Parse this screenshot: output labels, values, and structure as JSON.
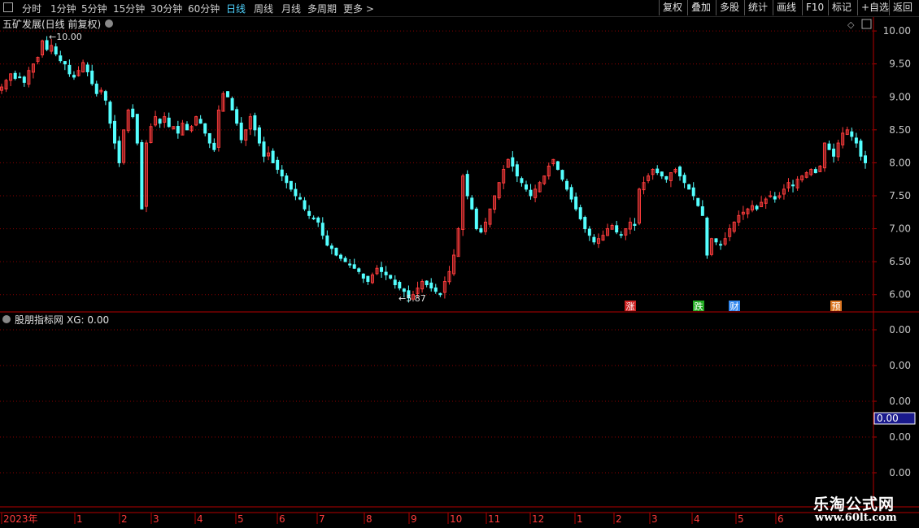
{
  "toolbar": {
    "periods": [
      "分时",
      "1分钟",
      "5分钟",
      "15分钟",
      "30分钟",
      "60分钟",
      "日线",
      "周线",
      "月线",
      "多周期",
      "更多 >"
    ],
    "active_period": "日线",
    "right_buttons": [
      "复权",
      "叠加",
      "多股",
      "统计",
      "画线",
      "F10",
      "标记",
      "+自选",
      "返回"
    ]
  },
  "main_panel": {
    "title": "五矿发展(日线 前复权)",
    "high_label": "10.00",
    "low_label": "5.87",
    "y_ticks": [
      "10.00",
      "9.50",
      "9.00",
      "8.50",
      "8.00",
      "7.50",
      "7.00",
      "6.50",
      "6.00"
    ],
    "event_markers": [
      {
        "label": "涨",
        "color": "#cc2222"
      },
      {
        "label": "跌",
        "color": "#22aa22"
      },
      {
        "label": "财",
        "color": "#3388ee"
      },
      {
        "label": "预",
        "color": "#dd7722"
      }
    ]
  },
  "indicator_panel": {
    "title": "股朋指标网",
    "value_label": "XG: 0.00",
    "y_ticks": [
      "0.00",
      "0.00",
      "0.00",
      "0.00",
      "0.00"
    ],
    "current_value": "0.00"
  },
  "time_axis": [
    "2023年",
    "1",
    "2",
    "3",
    "4",
    "5",
    "6",
    "7",
    "8",
    "9",
    "10",
    "11",
    "12",
    "1",
    "2",
    "3",
    "4",
    "5",
    "6"
  ],
  "watermark": {
    "line1": "乐淘公式网",
    "line2": "www.60lt.com"
  },
  "colors": {
    "up": "#ff3c3c",
    "down": "#54ffff",
    "grid": "#8b0000",
    "frame": "#b40000",
    "axis_text": "#c8c8c8",
    "highlight": "#1a1a8c"
  },
  "chart_data": {
    "type": "candlestick",
    "x_range": [
      "2023-01",
      "2024-06"
    ],
    "ylim": [
      5.75,
      10.1
    ],
    "closes": [
      9.15,
      9.25,
      9.35,
      9.28,
      9.3,
      9.22,
      9.4,
      9.5,
      9.6,
      9.85,
      9.72,
      9.78,
      9.65,
      9.55,
      9.5,
      9.35,
      9.3,
      9.4,
      9.52,
      9.38,
      9.2,
      9.05,
      9.1,
      8.95,
      8.6,
      8.3,
      8.0,
      8.5,
      8.8,
      8.7,
      8.3,
      7.3,
      8.3,
      8.55,
      8.7,
      8.6,
      8.7,
      8.55,
      8.55,
      8.45,
      8.6,
      8.5,
      8.55,
      8.7,
      8.6,
      8.45,
      8.3,
      8.2,
      8.8,
      9.05,
      9.0,
      8.8,
      8.6,
      8.35,
      8.5,
      8.7,
      8.5,
      8.3,
      8.1,
      8.15,
      8.0,
      7.9,
      7.8,
      7.7,
      7.6,
      7.5,
      7.45,
      7.3,
      7.2,
      7.15,
      7.1,
      6.9,
      6.75,
      6.7,
      6.6,
      6.55,
      6.5,
      6.45,
      6.4,
      6.35,
      6.25,
      6.2,
      6.3,
      6.4,
      6.35,
      6.3,
      6.25,
      6.15,
      6.1,
      6.05,
      5.95,
      6.0,
      6.1,
      6.2,
      6.15,
      6.1,
      6.05,
      6.0,
      6.2,
      6.35,
      6.6,
      7.0,
      7.8,
      7.5,
      7.3,
      7.0,
      6.95,
      7.1,
      7.3,
      7.5,
      7.7,
      7.9,
      8.05,
      7.95,
      7.8,
      7.7,
      7.6,
      7.5,
      7.6,
      7.7,
      7.8,
      7.95,
      8.05,
      7.9,
      7.75,
      7.6,
      7.45,
      7.3,
      7.15,
      7.0,
      6.9,
      6.8,
      6.85,
      6.9,
      7.0,
      7.05,
      6.95,
      6.9,
      7.0,
      7.1,
      7.05,
      7.6,
      7.7,
      7.8,
      7.9,
      7.85,
      7.8,
      7.75,
      7.85,
      7.9,
      7.8,
      7.7,
      7.6,
      7.5,
      7.35,
      7.2,
      6.6,
      6.85,
      6.8,
      6.75,
      6.85,
      7.0,
      7.1,
      7.2,
      7.25,
      7.3,
      7.35,
      7.3,
      7.4,
      7.45,
      7.5,
      7.45,
      7.5,
      7.6,
      7.7,
      7.65,
      7.75,
      7.8,
      7.85,
      7.9,
      7.85,
      7.95,
      8.3,
      8.2,
      8.1,
      8.3,
      8.45,
      8.5,
      8.4,
      8.3,
      8.1,
      8.0
    ]
  }
}
